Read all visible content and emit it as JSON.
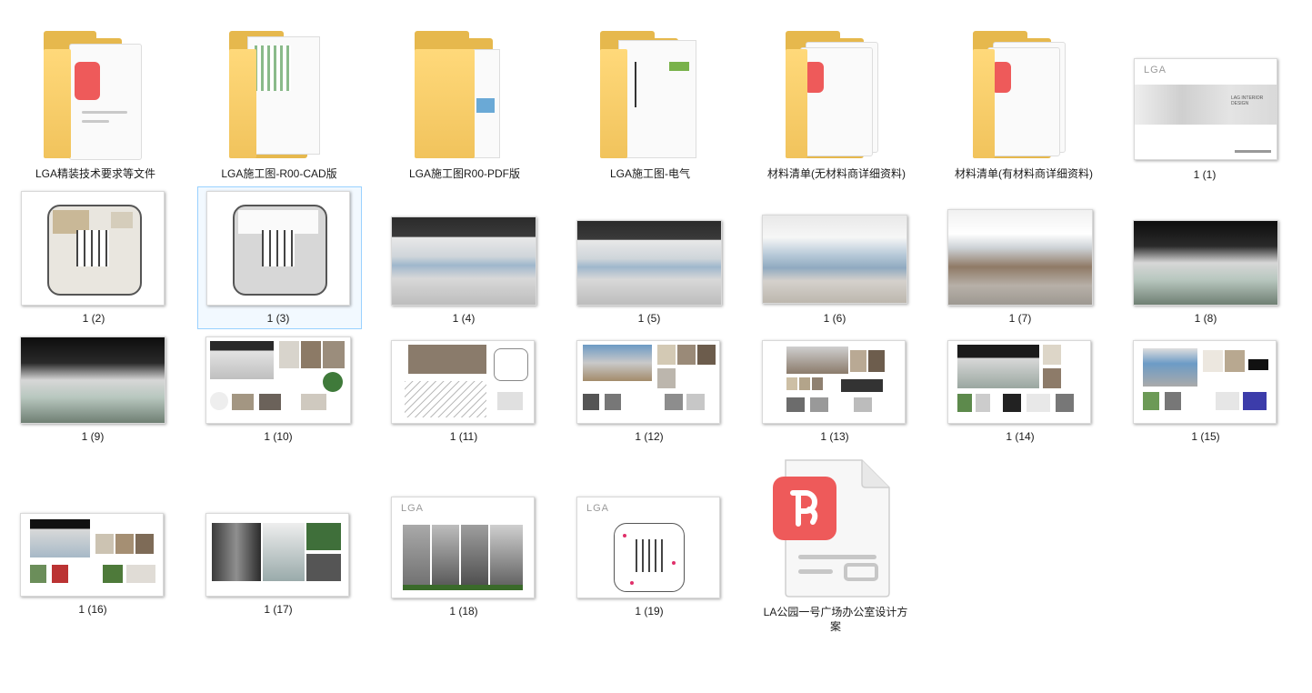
{
  "window": {
    "view": "large-icons"
  },
  "items": [
    {
      "label": "LGA精装技术要求等文件",
      "type": "folder-pdf"
    },
    {
      "label": "LGA施工图-R00-CAD版",
      "type": "folder-drawings"
    },
    {
      "label": "LGA施工图R00-PDF版",
      "type": "folder-docs"
    },
    {
      "label": "LGA施工图-电气",
      "type": "folder-drawings"
    },
    {
      "label": "材料清单(无材料商详细资料)",
      "type": "folder-pdf"
    },
    {
      "label": "材料清单(有材料商详细资料)",
      "type": "folder-pdf"
    },
    {
      "label": "1 (1)",
      "type": "image"
    },
    {
      "label": "1 (2)",
      "type": "image"
    },
    {
      "label": "1 (3)",
      "type": "image",
      "selected": true
    },
    {
      "label": "1 (4)",
      "type": "image"
    },
    {
      "label": "1 (5)",
      "type": "image"
    },
    {
      "label": "1 (6)",
      "type": "image"
    },
    {
      "label": "1 (7)",
      "type": "image"
    },
    {
      "label": "1 (8)",
      "type": "image"
    },
    {
      "label": "1 (9)",
      "type": "image"
    },
    {
      "label": "1 (10)",
      "type": "image"
    },
    {
      "label": "1 (11)",
      "type": "image"
    },
    {
      "label": "1 (12)",
      "type": "image"
    },
    {
      "label": "1 (13)",
      "type": "image"
    },
    {
      "label": "1 (14)",
      "type": "image"
    },
    {
      "label": "1 (15)",
      "type": "image"
    },
    {
      "label": "1 (16)",
      "type": "image"
    },
    {
      "label": "1 (17)",
      "type": "image"
    },
    {
      "label": "1 (18)",
      "type": "image"
    },
    {
      "label": "1 (19)",
      "type": "image"
    },
    {
      "label": "LA公园一号广场办公室设计方案",
      "type": "pdf"
    }
  ],
  "thumb_text": {
    "lga": "LGA",
    "lga_design": "LAG INTERIOR DESIGN"
  },
  "colors": {
    "folder": "#f1c35c",
    "pdf_badge": "#ee5a5a",
    "selection": "#99d1ff"
  }
}
